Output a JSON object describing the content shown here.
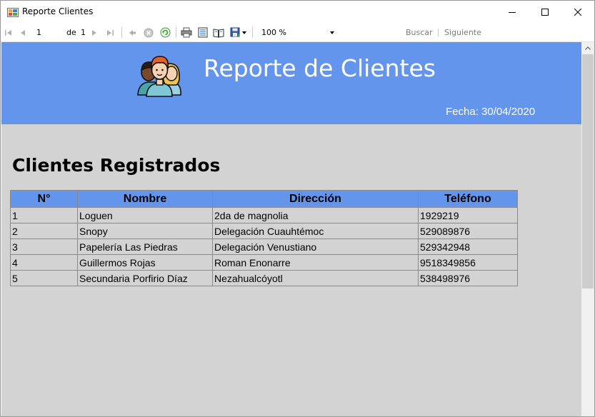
{
  "window": {
    "title": "Reporte Clientes",
    "icon": "report-app-icon"
  },
  "toolbar": {
    "current_page": "1",
    "of_label": "de",
    "total_pages": "1",
    "zoom": "100 %",
    "search_label": "Buscar",
    "next_label": "Siguiente"
  },
  "report": {
    "title": "Reporte de Clientes",
    "date": "Fecha: 30/04/2020",
    "section_title": "Clientes Registrados",
    "columns": [
      "N°",
      "Nombre",
      "Dirección",
      "Teléfono"
    ],
    "rows": [
      [
        "1",
        "Loguen",
        "2da de magnolia",
        "1929219"
      ],
      [
        "2",
        "Snopy",
        "Delegación Cuauhtémoc",
        "529089876"
      ],
      [
        "3",
        "Papelería Las Piedras",
        "Delegación Venustiano",
        "529342948"
      ],
      [
        "4",
        "Guillermos Rojas",
        "Roman Enonarre",
        "9518349856"
      ],
      [
        "5",
        "Secundaria Porfirio Díaz",
        "Nezahualcóyotl",
        "538498976"
      ]
    ]
  },
  "colors": {
    "header_bg": "#6495ed",
    "viewer_bg": "#d3d3d3",
    "title_text": "#ffffff"
  }
}
